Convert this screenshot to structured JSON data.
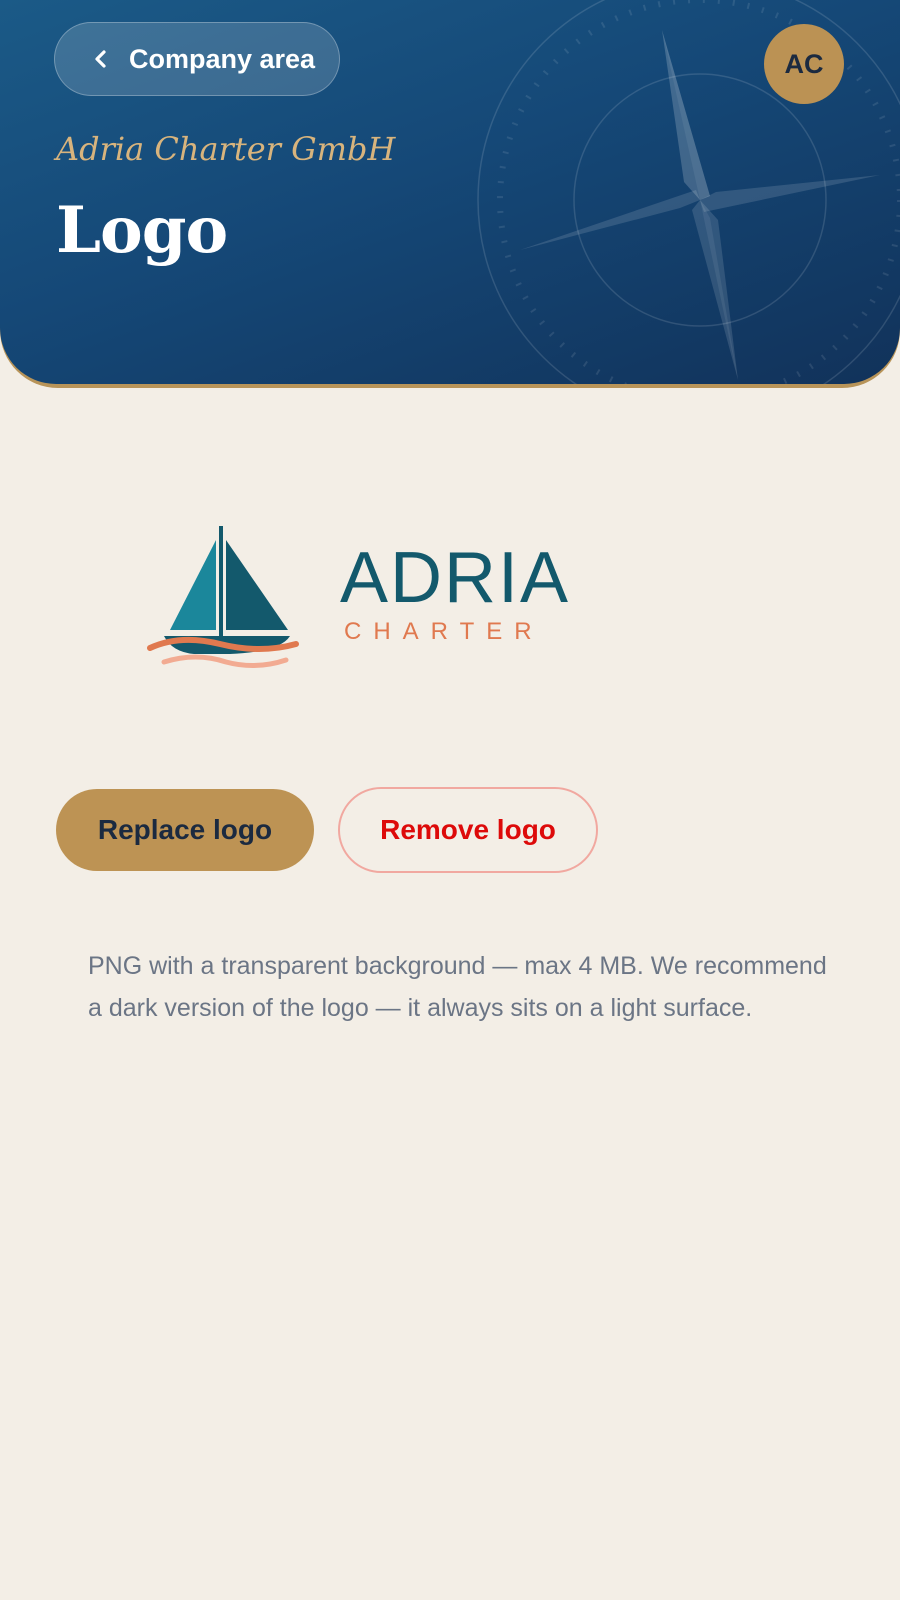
{
  "header": {
    "back_label": "Company area",
    "back_icon": "chevron-left-icon",
    "avatar_initials": "AC",
    "company_name": "Adria Charter GmbH",
    "page_title": "Logo"
  },
  "logo": {
    "name": "ADRIA",
    "tagline": "CHARTER",
    "icon": "sailboat-icon",
    "colors": {
      "teal": "#13596c",
      "coral": "#e0794f"
    }
  },
  "actions": {
    "replace_label": "Replace logo",
    "remove_label": "Remove logo"
  },
  "hint_text": "PNG with a transparent background — max 4 MB. We recommend a dark version of the logo — it always sits on a light surface.",
  "colors": {
    "header_blue": "#154877",
    "accent_gold": "#bd9354",
    "danger_red": "#dd0a0a",
    "background": "#f3eee6"
  }
}
